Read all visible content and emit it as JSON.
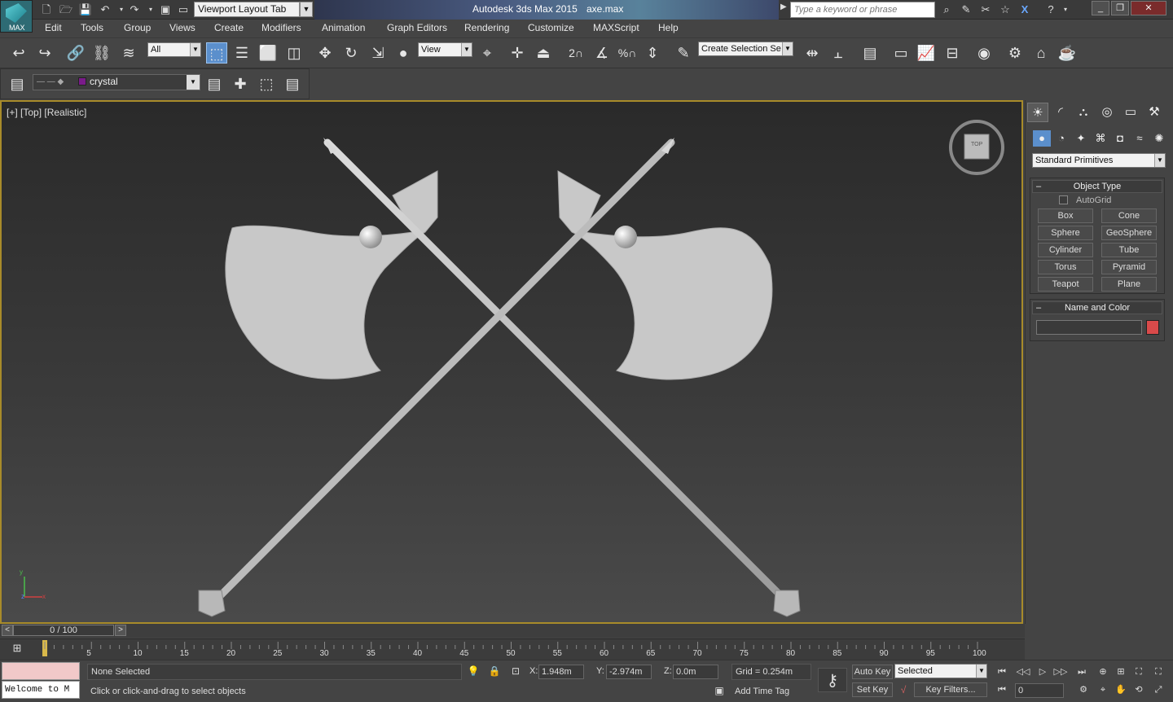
{
  "titlebar": {
    "logo_text": "MAX",
    "workspace": "Viewport Layout Tab",
    "app_title": "Autodesk 3ds Max  2015",
    "file_name": "axe.max",
    "search_placeholder": "Type a keyword or phrase"
  },
  "menu": {
    "items": [
      "Edit",
      "Tools",
      "Group",
      "Views",
      "Create",
      "Modifiers",
      "Animation",
      "Graph Editors",
      "Rendering",
      "Customize",
      "MAXScript",
      "Help"
    ]
  },
  "toolbar": {
    "selection_filter": "All",
    "ref_coord": "View",
    "snap_labels": [
      "2",
      "%"
    ],
    "named_selection": "Create Selection Se"
  },
  "layer_toolbar": {
    "layer_name": "crystal"
  },
  "viewport": {
    "label": "[+] [Top] [Realistic]",
    "viewcube_label": "TOP",
    "axis_x": "x",
    "axis_y": "y",
    "axis_z": "z"
  },
  "command_panel": {
    "category": "Standard Primitives",
    "object_type_title": "Object Type",
    "autogrid_label": "AutoGrid",
    "primitives": [
      "Box",
      "Cone",
      "Sphere",
      "GeoSphere",
      "Cylinder",
      "Tube",
      "Torus",
      "Pyramid",
      "Teapot",
      "Plane"
    ],
    "name_color_title": "Name and Color",
    "object_color": "#d94a4a"
  },
  "timeline": {
    "position": "0 / 100",
    "ticks": [
      "5",
      "10",
      "15",
      "20",
      "25",
      "30",
      "35",
      "40",
      "45",
      "50",
      "55",
      "60",
      "65",
      "70",
      "75",
      "80",
      "85",
      "90",
      "95",
      "100"
    ]
  },
  "status": {
    "maxscript_text": "Welcome to M",
    "selection": "None Selected",
    "prompt": "Click or click-and-drag to select objects",
    "x_label": "X:",
    "x_value": "1.948m",
    "y_label": "Y:",
    "y_value": "-2.974m",
    "z_label": "Z:",
    "z_value": "0.0m",
    "grid": "Grid = 0.254m",
    "add_time_tag": "Add Time Tag",
    "auto_key": "Auto Key",
    "set_key": "Set Key",
    "key_mode": "Selected",
    "key_filters": "Key Filters...",
    "current_frame": "0"
  },
  "colors": {
    "viewport_border": "#a88b2a",
    "active_tool": "#5b8fcc",
    "model": "#c8c8c8"
  }
}
